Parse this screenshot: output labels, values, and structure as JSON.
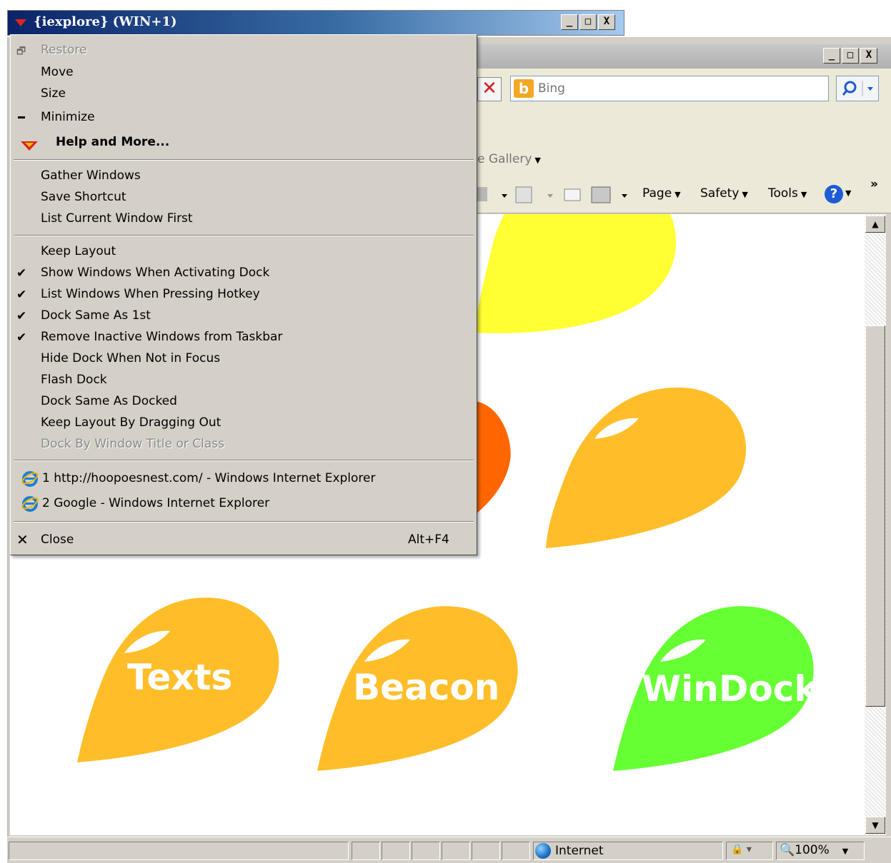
{
  "colors": {
    "titlebar_start": "#0a246a",
    "titlebar_end": "#a6caf0",
    "menu_bg": "#d4d0c8",
    "drop_yellow": "#ffff33",
    "drop_orange": "#ffbe29",
    "drop_red_orange": "#ff6600",
    "drop_green": "#66ff33"
  },
  "float_window": {
    "title": "{iexplore} (WIN+1)",
    "menu_icon": "red-triangle-icon",
    "buttons": [
      "_",
      "□",
      "X"
    ]
  },
  "ie_window": {
    "caption_buttons": [
      "_",
      "□",
      "X"
    ],
    "search": {
      "provider": "Bing",
      "placeholder": "Bing"
    },
    "stop_icon": "x-icon",
    "favorites_bar": {
      "gallery": "e Gallery"
    },
    "command_bar": {
      "page": "Page",
      "safety": "Safety",
      "tools": "Tools",
      "help": "?",
      "chevron": "»"
    }
  },
  "content": {
    "drops": [
      {
        "label": "Texts",
        "color": "#ffbe29"
      },
      {
        "label": "Beacon",
        "color": "#ffbe29"
      },
      {
        "label": "WinDock",
        "color": "#66ff33"
      }
    ]
  },
  "status_bar": {
    "zone": "Internet",
    "zoom": "100%"
  },
  "menu": {
    "items": [
      {
        "label": "Restore",
        "disabled": true,
        "icon": "restore-icon"
      },
      {
        "label": "Move"
      },
      {
        "label": "Size"
      },
      {
        "label": "Minimize",
        "icon": "minimize-icon"
      },
      {
        "label": "Help and More...",
        "icon": "red-triangle-icon",
        "bold": true
      },
      {
        "label": "Gather Windows"
      },
      {
        "label": "Save Shortcut"
      },
      {
        "label": "List Current Window First"
      },
      {
        "label": "Keep Layout"
      },
      {
        "label": "Show Windows When Activating Dock",
        "checked": true
      },
      {
        "label": "List Windows When Pressing Hotkey",
        "checked": true
      },
      {
        "label": "Dock Same As 1st",
        "checked": true
      },
      {
        "label": "Remove Inactive Windows from Taskbar",
        "checked": true
      },
      {
        "label": "Hide Dock When Not in Focus"
      },
      {
        "label": "Flash Dock"
      },
      {
        "label": "Dock Same As Docked"
      },
      {
        "label": "Keep Layout By Dragging Out"
      },
      {
        "label": "Dock By Window Title or Class",
        "disabled": true
      },
      {
        "label": "1 http://hoopoesnest.com/ - Windows Internet Explorer",
        "icon": "ie-icon"
      },
      {
        "label": "2 Google - Windows Internet Explorer",
        "icon": "ie-icon"
      },
      {
        "label": "Close",
        "shortcut": "Alt+F4",
        "icon": "close-icon"
      }
    ]
  }
}
